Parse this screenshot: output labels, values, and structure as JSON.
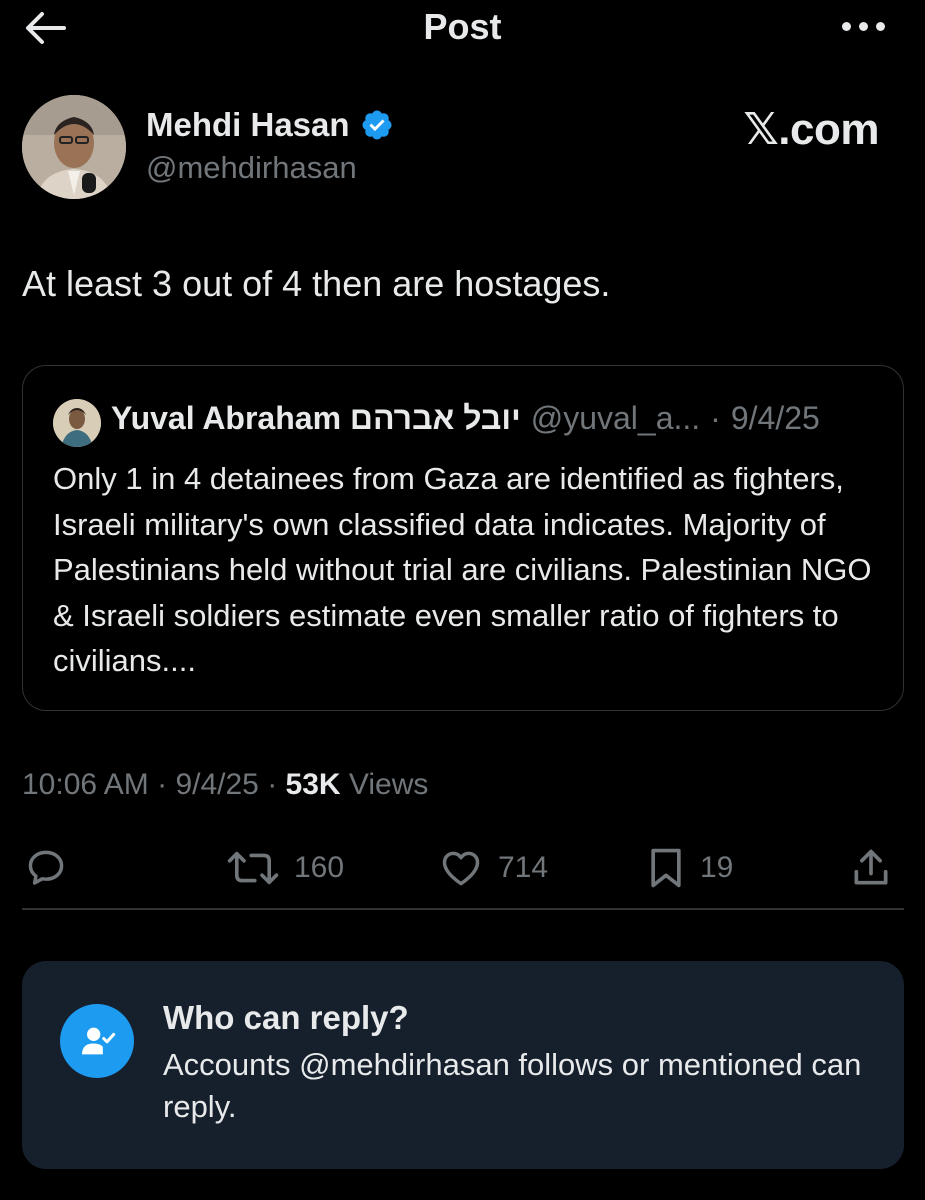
{
  "header": {
    "title": "Post",
    "back_icon": "arrow-left-icon",
    "more_icon": "more-horizontal-icon"
  },
  "author": {
    "name": "Mehdi Hasan",
    "handle": "@mehdirhasan",
    "verified_icon": "verified-badge-icon",
    "verified_color": "#1d9bf0"
  },
  "watermark": "𝕏.com",
  "post": {
    "text": "At least 3 out of 4 then are hostages."
  },
  "quote": {
    "name": "Yuval Abraham יובל אברהם",
    "handle": "@yuval_a...",
    "separator": "·",
    "date": "9/4/25",
    "text": "Only 1 in 4 detainees from Gaza are identified as fighters, Israeli military's own classified data indicates. Majority of Palestinians held without trial are civilians. Palestinian NGO & Israeli soldiers estimate even smaller ratio of fighters to civilians...."
  },
  "meta": {
    "time": "10:06 AM",
    "sep1": " · ",
    "date": "9/4/25",
    "sep2": " · ",
    "views_count": "53K",
    "views_label": " Views"
  },
  "actions": {
    "reply_icon": "reply-bubble-icon",
    "retweet_icon": "retweet-icon",
    "retweets": "160",
    "like_icon": "heart-icon",
    "likes": "714",
    "bookmark_icon": "bookmark-icon",
    "bookmarks": "19",
    "share_icon": "share-icon"
  },
  "reply_settings": {
    "title": "Who can reply?",
    "description": "Accounts @mehdirhasan follows or mentioned can reply.",
    "icon": "person-check-icon",
    "accent": "#1d9bf0"
  },
  "colors": {
    "background": "#000000",
    "text": "#e7e9ea",
    "muted": "#71767b",
    "border": "#2f3336",
    "card_bg": "#16202c"
  }
}
